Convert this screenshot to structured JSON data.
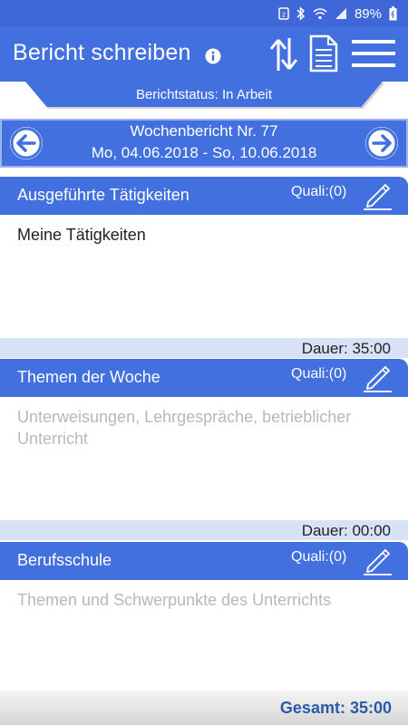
{
  "statusbar": {
    "battery": "89%",
    "icons": [
      "sim-icon",
      "bluetooth-icon",
      "wifi-icon",
      "signal-icon",
      "battery-icon"
    ]
  },
  "appbar": {
    "title": "Bericht schreiben",
    "icons": [
      "info-icon",
      "sort-icon",
      "document-icon",
      "menu-icon"
    ]
  },
  "status": {
    "label": "Berichtstatus: In Arbeit"
  },
  "week": {
    "title": "Wochenbericht Nr. 77",
    "range": "Mo, 04.06.2018 - So, 10.06.2018"
  },
  "sections": [
    {
      "title": "Ausgeführte Tätigkeiten",
      "quali": "Quali:(0)",
      "text": "Meine Tätigkeiten",
      "is_placeholder": false,
      "duration": "Dauer: 35:00"
    },
    {
      "title": "Themen der Woche",
      "quali": "Quali:(0)",
      "text": "Unterweisungen, Lehrgespräche, betrieblicher Unterricht",
      "is_placeholder": true,
      "duration": "Dauer: 00:00"
    },
    {
      "title": "Berufsschule",
      "quali": "Quali:(0)",
      "text": "Themen und Schwerpunkte des Unterrichts",
      "is_placeholder": true,
      "duration": ""
    }
  ],
  "total": {
    "label": "Gesamt:  35:00"
  },
  "colors": {
    "primary": "#4270de",
    "footer_band": "#d8e2f7",
    "total_text": "#2a5aa8",
    "placeholder_text": "#b8b8b8"
  }
}
